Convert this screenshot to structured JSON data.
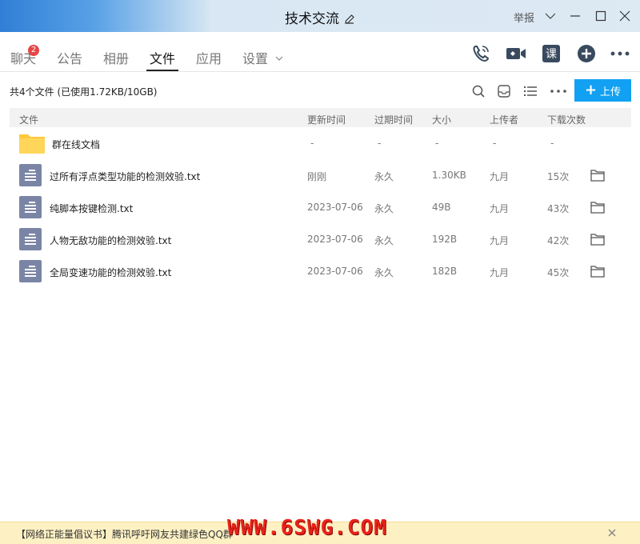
{
  "window": {
    "title": "技术交流",
    "report_label": "举报"
  },
  "tabs": [
    {
      "label": "聊天",
      "badge": "2"
    },
    {
      "label": "公告"
    },
    {
      "label": "相册"
    },
    {
      "label": "文件",
      "active": true
    },
    {
      "label": "应用"
    },
    {
      "label": "设置"
    }
  ],
  "toolbar": {
    "summary": "共4个文件 (已使用1.72KB/10GB)",
    "upload_label": "上传"
  },
  "table": {
    "headers": [
      "文件",
      "更新时间",
      "过期时间",
      "大小",
      "上传者",
      "下载次数"
    ],
    "folder": {
      "name": "群在线文档",
      "updated": "-",
      "expires": "-",
      "size": "-",
      "uploader": "-",
      "downloads": "-"
    },
    "rows": [
      {
        "name": "过所有浮点类型功能的检测效验.txt",
        "updated": "刚刚",
        "expires": "永久",
        "size": "1.30KB",
        "uploader": "九月",
        "downloads": "15次"
      },
      {
        "name": "纯脚本按键检测.txt",
        "updated": "2023-07-06",
        "expires": "永久",
        "size": "49B",
        "uploader": "九月",
        "downloads": "43次"
      },
      {
        "name": "人物无敌功能的检测效验.txt",
        "updated": "2023-07-06",
        "expires": "永久",
        "size": "192B",
        "uploader": "九月",
        "downloads": "42次"
      },
      {
        "name": "全局变速功能的检测效验.txt",
        "updated": "2023-07-06",
        "expires": "永久",
        "size": "182B",
        "uploader": "九月",
        "downloads": "45次"
      }
    ]
  },
  "footer": {
    "notice": "【网络正能量倡议书】腾讯呼吁网友共建绿色QQ群",
    "watermark": "WWW.6SWG.COM"
  },
  "colors": {
    "accent": "#12a1f2",
    "icon_dark": "#394a5e",
    "file_icon": "#7a85a6",
    "folder": "#ffcc33",
    "badge": "#e64545",
    "watermark": "#e8231a"
  }
}
